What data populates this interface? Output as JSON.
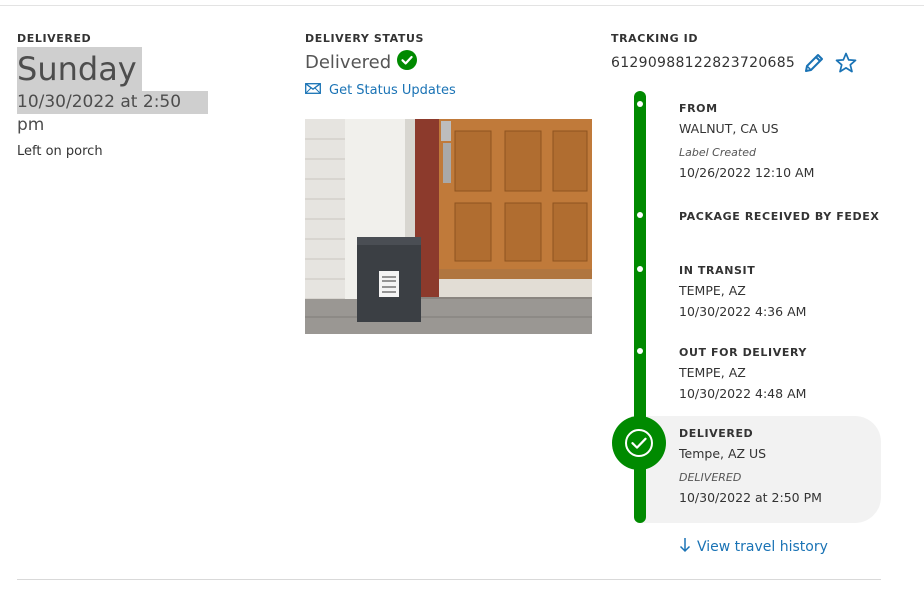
{
  "delivered_section": {
    "label": "DELIVERED",
    "day": "Sunday",
    "datetime": "10/30/2022 at 2:50 pm",
    "note": "Left on porch"
  },
  "status_section": {
    "label": "DELIVERY STATUS",
    "status": "Delivered",
    "updates_link": "Get Status Updates"
  },
  "tracking_section": {
    "label": "TRACKING ID",
    "tracking_id": "612909881228237206​85"
  },
  "timeline": {
    "from": {
      "title": "FROM",
      "location": "WALNUT, CA US",
      "sub": "Label Created",
      "time": "10/26/2022 12:10 AM"
    },
    "received": {
      "title": "PACKAGE RECEIVED BY FEDEX"
    },
    "transit": {
      "title": "IN TRANSIT",
      "location": "TEMPE, AZ",
      "time": "10/30/2022 4:36 AM"
    },
    "out": {
      "title": "OUT FOR DELIVERY",
      "location": "TEMPE, AZ",
      "time": "10/30/2022 4:48 AM"
    },
    "delivered": {
      "title": "DELIVERED",
      "location": "Tempe, AZ US",
      "sub": "DELIVERED",
      "time": "10/30/2022 at 2:50 PM"
    }
  },
  "history_link": "View travel history",
  "colors": {
    "green": "#008a00",
    "link": "#1a73b5"
  }
}
